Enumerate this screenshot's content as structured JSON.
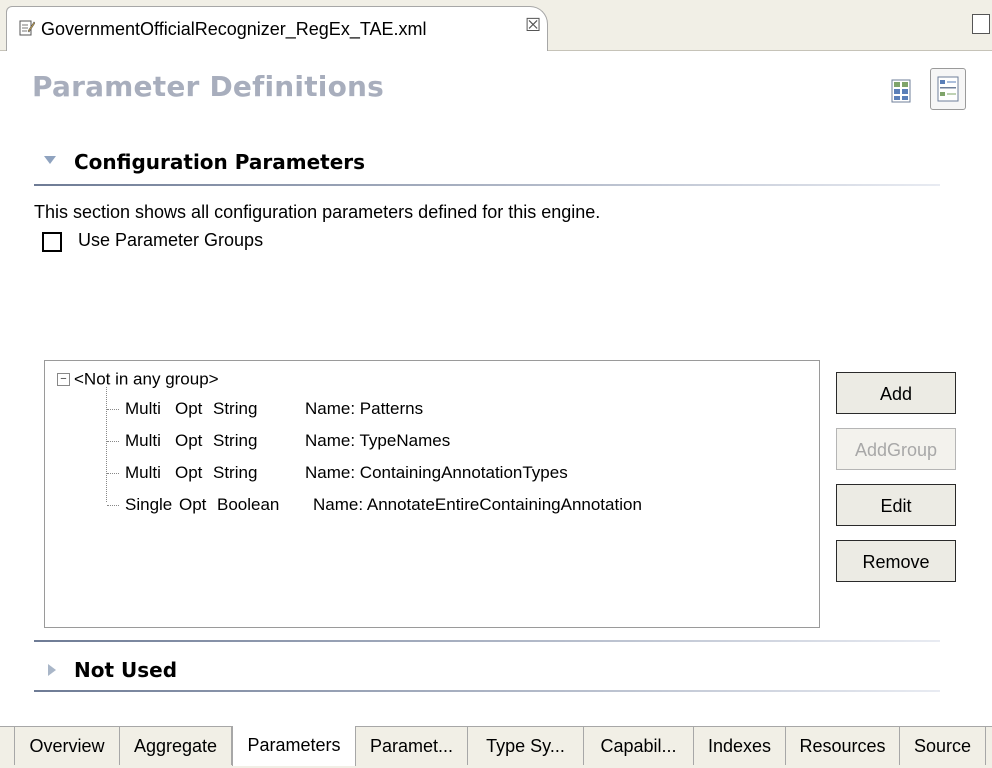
{
  "editor": {
    "tab_title": "GovernmentOfficialRecognizer_RegEx_TAE.xml",
    "close_glyph": "☒",
    "file_icon": "edit-file-icon"
  },
  "page": {
    "title": "Parameter Definitions"
  },
  "config_section": {
    "title": "Configuration Parameters",
    "description": "This section shows all configuration parameters defined for this engine.",
    "use_groups_label": "Use Parameter Groups",
    "use_groups_checked": false
  },
  "tree": {
    "root_label": "<Not in any group>",
    "expander": "−",
    "rows": [
      {
        "multiplicity": "Multi",
        "opt": "Opt",
        "type": "String",
        "name": "Name: Patterns"
      },
      {
        "multiplicity": "Multi",
        "opt": "Opt",
        "type": "String",
        "name": "Name: TypeNames"
      },
      {
        "multiplicity": "Multi",
        "opt": "Opt",
        "type": "String",
        "name": "Name: ContainingAnnotationTypes"
      },
      {
        "multiplicity": "Single",
        "opt": "Opt",
        "type": "Boolean",
        "name": "Name: AnnotateEntireContainingAnnotation"
      }
    ]
  },
  "buttons": {
    "add": "Add",
    "add_group": "AddGroup",
    "edit": "Edit",
    "remove": "Remove"
  },
  "not_used_section": {
    "title": "Not Used"
  },
  "bottom_tabs": [
    "Overview",
    "Aggregate",
    "Parameters",
    "Paramet...",
    "Type Sy...",
    "Capabil...",
    "Indexes",
    "Resources",
    "Source"
  ],
  "active_bottom_tab": "Parameters",
  "colors": {
    "title_color": "#a8aebd",
    "tab_bar_bg": "#f1efe6"
  }
}
